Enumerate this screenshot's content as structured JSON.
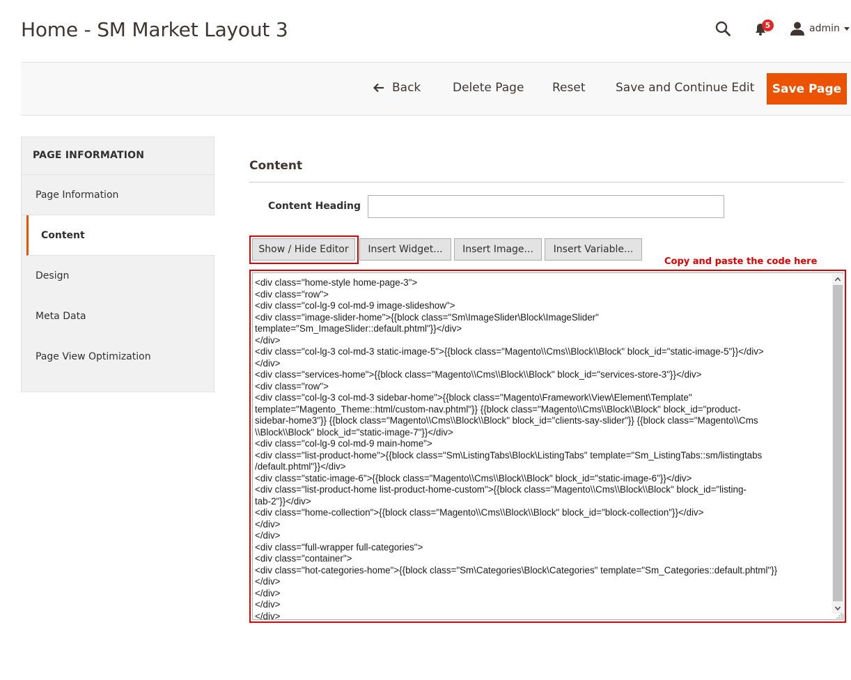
{
  "header": {
    "title": "Home - SM Market Layout 3",
    "notifications_count": "5",
    "user_label": "admin",
    "icons": [
      "search-icon",
      "bell-icon",
      "user-icon",
      "caret-down-icon"
    ]
  },
  "actions": {
    "back_label": "Back",
    "delete_label": "Delete Page",
    "reset_label": "Reset",
    "save_continue_label": "Save and Continue Edit",
    "save_label": "Save Page"
  },
  "sidebar": {
    "title": "PAGE INFORMATION",
    "items": [
      {
        "label": "Page Information"
      },
      {
        "label": "Content",
        "active": true
      },
      {
        "label": "Design"
      },
      {
        "label": "Meta Data"
      },
      {
        "label": "Page View Optimization"
      }
    ]
  },
  "content": {
    "section_title": "Content",
    "heading_label": "Content Heading",
    "heading_value": "",
    "buttons": {
      "show_hide": "Show / Hide Editor",
      "insert_widget": "Insert Widget...",
      "insert_image": "Insert Image...",
      "insert_variable": "Insert Variable..."
    },
    "hint": "Copy and paste the code here",
    "code_lines": [
      "<div class=\"home-style home-page-3\">",
      "<div class=\"row\">",
      "<div class=\"col-lg-9 col-md-9 image-slideshow\">",
      "<div class=\"image-slider-home\">{{block class=\"Sm\\ImageSlider\\Block\\ImageSlider\"",
      "template=\"Sm_ImageSlider::default.phtml\"}}</div>",
      "</div>",
      "<div class=\"col-lg-3 col-md-3 static-image-5\">{{block class=\"Magento\\\\Cms\\\\Block\\\\Block\" block_id=\"static-image-5\"}}</div>",
      "</div>",
      "<div class=\"services-home\">{{block class=\"Magento\\\\Cms\\\\Block\\\\Block\" block_id=\"services-store-3\"}}</div>",
      "<div class=\"row\">",
      "<div class=\"col-lg-3 col-md-3 sidebar-home\">{{block class=\"Magento\\Framework\\View\\Element\\Template\"",
      "template=\"Magento_Theme::html/custom-nav.phtml\"}} {{block class=\"Magento\\\\Cms\\\\Block\\\\Block\" block_id=\"product-",
      "sidebar-home3\"}} {{block class=\"Magento\\\\Cms\\\\Block\\\\Block\" block_id=\"clients-say-slider\"}} {{block class=\"Magento\\\\Cms",
      "\\\\Block\\\\Block\" block_id=\"static-image-7\"}}</div>",
      "<div class=\"col-lg-9 col-md-9 main-home\">",
      "<div class=\"list-product-home\">{{block class=\"Sm\\ListingTabs\\Block\\ListingTabs\" template=\"Sm_ListingTabs::sm/listingtabs",
      "/default.phtml\"}}</div>",
      "<div class=\"static-image-6\">{{block class=\"Magento\\\\Cms\\\\Block\\\\Block\" block_id=\"static-image-6\"}}</div>",
      "<div class=\"list-product-home list-product-home-custom\">{{block class=\"Magento\\\\Cms\\\\Block\\\\Block\" block_id=\"listing-",
      "tab-2\"}}</div>",
      "<div class=\"home-collection\">{{block class=\"Magento\\\\Cms\\\\Block\\\\Block\" block_id=\"block-collection\"}}</div>",
      "</div>",
      "</div>",
      "<div class=\"full-wrapper full-categories\">",
      "<div class=\"container\">",
      "<div class=\"hot-categories-home\">{{block class=\"Sm\\Categories\\Block\\Categories\" template=\"Sm_Categories::default.phtml\"}}",
      "</div>",
      "</div>",
      "</div>",
      "</div>"
    ]
  },
  "colors": {
    "accent": "#eb5202",
    "annotation_red": "#e00000",
    "badge_red": "#e22626",
    "text_dark": "#41362f"
  }
}
